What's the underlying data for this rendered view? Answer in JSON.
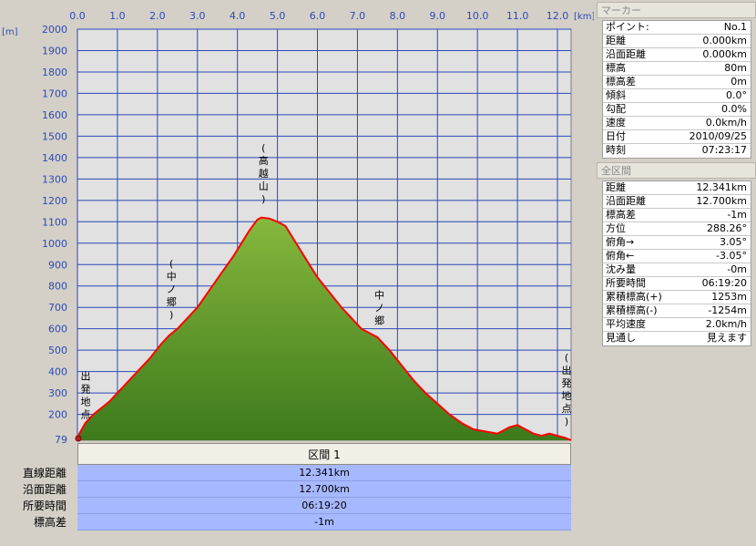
{
  "chart_data": {
    "type": "area",
    "x_unit": "[km]",
    "y_unit": "[m]",
    "x_ticks": [
      "0.0",
      "1.0",
      "2.0",
      "3.0",
      "4.0",
      "5.0",
      "6.0",
      "7.0",
      "8.0",
      "9.0",
      "10.0",
      "11.0",
      "12.0"
    ],
    "y_ticks": [
      "2000",
      "1900",
      "1800",
      "1700",
      "1600",
      "1500",
      "1400",
      "1300",
      "1200",
      "1100",
      "1000",
      "900",
      "800",
      "700",
      "600",
      "500",
      "400",
      "300",
      "200"
    ],
    "y_min_label": "79",
    "xlim": [
      0,
      12.341
    ],
    "ylim": [
      79,
      2000
    ],
    "x": [
      0,
      0.05,
      0.2,
      0.4,
      0.6,
      0.8,
      1.0,
      1.2,
      1.5,
      1.8,
      2.1,
      2.3,
      2.5,
      2.7,
      3.0,
      3.3,
      3.6,
      3.9,
      4.1,
      4.3,
      4.5,
      4.6,
      4.8,
      5.0,
      5.2,
      5.4,
      5.6,
      5.8,
      6.0,
      6.3,
      6.6,
      6.9,
      7.1,
      7.3,
      7.5,
      7.8,
      8.1,
      8.4,
      8.7,
      9.0,
      9.3,
      9.6,
      9.9,
      10.2,
      10.5,
      10.8,
      11.0,
      11.2,
      11.4,
      11.6,
      11.8,
      12.0,
      12.2,
      12.341
    ],
    "y": [
      80,
      110,
      160,
      200,
      230,
      260,
      300,
      340,
      400,
      460,
      530,
      570,
      600,
      640,
      700,
      780,
      860,
      940,
      1000,
      1060,
      1110,
      1120,
      1115,
      1100,
      1080,
      1020,
      960,
      900,
      840,
      770,
      700,
      640,
      600,
      580,
      560,
      500,
      430,
      360,
      300,
      250,
      200,
      160,
      130,
      120,
      110,
      140,
      150,
      130,
      110,
      100,
      110,
      100,
      90,
      79
    ],
    "annotations": [
      {
        "text": "出発地点",
        "x": 0.05
      },
      {
        "text": "(中ノ郷)",
        "x": 2.35
      },
      {
        "text": "(高越山)",
        "x": 4.65
      },
      {
        "text": "中ノ郷",
        "x": 7.55
      },
      {
        "text": "(出発地点)",
        "x": 12.341
      }
    ]
  },
  "section": {
    "header": "区間 1",
    "rows": [
      {
        "label": "直線距離",
        "value": "12.341km"
      },
      {
        "label": "沿面距離",
        "value": "12.700km"
      },
      {
        "label": "所要時間",
        "value": "06:19:20"
      },
      {
        "label": "標高差",
        "value": "-1m"
      }
    ]
  },
  "marker_panel": {
    "title": "マーカー",
    "rows": [
      {
        "k": "ポイント:",
        "v": "No.1"
      },
      {
        "k": "距離",
        "v": "0.000km"
      },
      {
        "k": "沿面距離",
        "v": "0.000km"
      },
      {
        "k": "標高",
        "v": "80m"
      },
      {
        "k": "標高差",
        "v": "0m"
      },
      {
        "k": "傾斜",
        "v": "0.0°"
      },
      {
        "k": "勾配",
        "v": "0.0%"
      },
      {
        "k": "速度",
        "v": "0.0km/h"
      },
      {
        "k": "日付",
        "v": "2010/09/25"
      },
      {
        "k": "時刻",
        "v": "07:23:17"
      }
    ]
  },
  "total_panel": {
    "title": "全区間",
    "rows": [
      {
        "k": "距離",
        "v": "12.341km"
      },
      {
        "k": "沿面距離",
        "v": "12.700km"
      },
      {
        "k": "標高差",
        "v": "-1m"
      },
      {
        "k": "方位",
        "v": "288.26°"
      },
      {
        "k": "俯角→",
        "v": "3.05°"
      },
      {
        "k": "俯角←",
        "v": "-3.05°"
      },
      {
        "k": "沈み量",
        "v": "-0m"
      },
      {
        "k": "所要時間",
        "v": "06:19:20"
      },
      {
        "k": "累積標高(+)",
        "v": "1253m"
      },
      {
        "k": "累積標高(-)",
        "v": "-1254m"
      },
      {
        "k": "平均速度",
        "v": "2.0km/h"
      },
      {
        "k": "見通し",
        "v": "見えます"
      }
    ]
  },
  "colors": {
    "plot_bg": "#e1e1e1",
    "grid": "#2b49b8",
    "fill_top": "#86b83d",
    "fill_bottom": "#3e7a1c",
    "profile_line": "#ff0000",
    "value_bg": "#a6b8ff"
  }
}
